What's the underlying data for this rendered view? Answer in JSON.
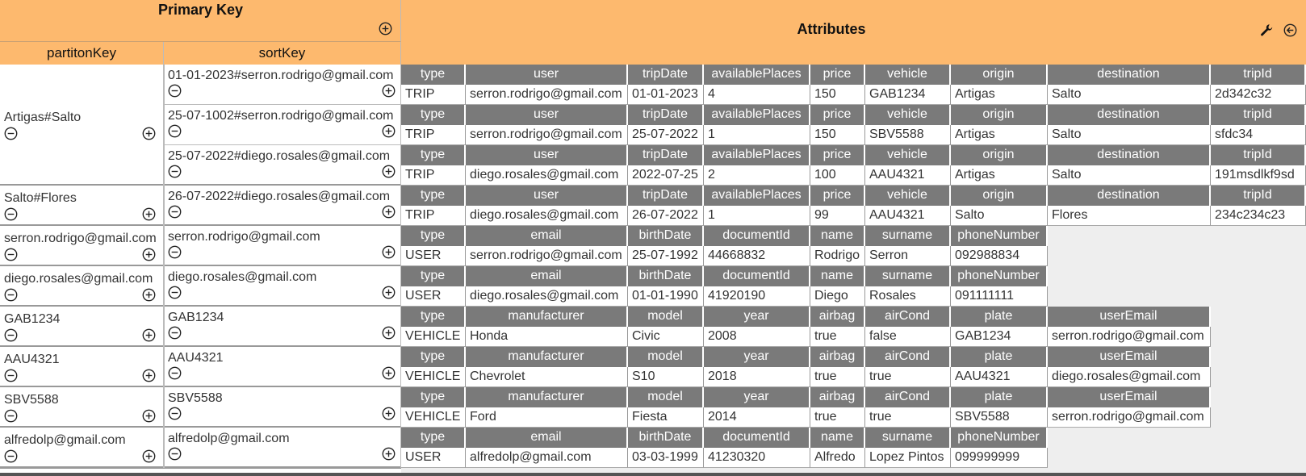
{
  "header": {
    "primary_key_title": "Primary Key",
    "attributes_title": "Attributes",
    "partition_col": "partitonKey",
    "sort_col": "sortKey"
  },
  "partitions": [
    {
      "key": "Artigas#Salto",
      "sorts": [
        "01-01-2023#serron.rodrigo@gmail.com",
        "25-07-1002#serron.rodrigo@gmail.com",
        "25-07-2022#diego.rosales@gmail.com"
      ]
    },
    {
      "key": "Salto#Flores",
      "sorts": [
        "26-07-2022#diego.rosales@gmail.com"
      ]
    },
    {
      "key": "serron.rodrigo@gmail.com",
      "sorts": [
        "serron.rodrigo@gmail.com"
      ]
    },
    {
      "key": "diego.rosales@gmail.com",
      "sorts": [
        "diego.rosales@gmail.com"
      ]
    },
    {
      "key": "GAB1234",
      "sorts": [
        "GAB1234"
      ]
    },
    {
      "key": "AAU4321",
      "sorts": [
        "AAU4321"
      ]
    },
    {
      "key": "SBV5588",
      "sorts": [
        "SBV5588"
      ]
    },
    {
      "key": "alfredolp@gmail.com",
      "sorts": [
        "alfredolp@gmail.com"
      ]
    }
  ],
  "items": [
    {
      "headers": [
        "type",
        "user",
        "tripDate",
        "availablePlaces",
        "price",
        "vehicle",
        "origin",
        "destination",
        "tripId"
      ],
      "values": [
        "TRIP",
        "serron.rodrigo@gmail.com",
        "01-01-2023",
        "4",
        "150",
        "GAB1234",
        "Artigas",
        "Salto",
        "2d342c32"
      ]
    },
    {
      "headers": [
        "type",
        "user",
        "tripDate",
        "availablePlaces",
        "price",
        "vehicle",
        "origin",
        "destination",
        "tripId"
      ],
      "values": [
        "TRIP",
        "serron.rodrigo@gmail.com",
        "25-07-2022",
        "1",
        "150",
        "SBV5588",
        "Artigas",
        "Salto",
        "sfdc34"
      ]
    },
    {
      "headers": [
        "type",
        "user",
        "tripDate",
        "availablePlaces",
        "price",
        "vehicle",
        "origin",
        "destination",
        "tripId"
      ],
      "values": [
        "TRIP",
        "diego.rosales@gmail.com",
        "2022-07-25",
        "2",
        "100",
        "AAU4321",
        "Artigas",
        "Salto",
        "191msdlkf9sd"
      ]
    },
    {
      "headers": [
        "type",
        "user",
        "tripDate",
        "availablePlaces",
        "price",
        "vehicle",
        "origin",
        "destination",
        "tripId"
      ],
      "values": [
        "TRIP",
        "diego.rosales@gmail.com",
        "26-07-2022",
        "1",
        "99",
        "AAU4321",
        "Salto",
        "Flores",
        "234c234c23"
      ]
    },
    {
      "headers": [
        "type",
        "email",
        "birthDate",
        "documentId",
        "name",
        "surname",
        "phoneNumber"
      ],
      "values": [
        "USER",
        "serron.rodrigo@gmail.com",
        "25-07-1992",
        "44668832",
        "Rodrigo",
        "Serron",
        "092988834"
      ]
    },
    {
      "headers": [
        "type",
        "email",
        "birthDate",
        "documentId",
        "name",
        "surname",
        "phoneNumber"
      ],
      "values": [
        "USER",
        "diego.rosales@gmail.com",
        "01-01-1990",
        "41920190",
        "Diego",
        "Rosales",
        "091111111"
      ]
    },
    {
      "headers": [
        "type",
        "manufacturer",
        "model",
        "year",
        "airbag",
        "airCond",
        "plate",
        "userEmail"
      ],
      "values": [
        "VEHICLE",
        "Honda",
        "Civic",
        "2008",
        "true",
        "false",
        "GAB1234",
        "serron.rodrigo@gmail.com"
      ]
    },
    {
      "headers": [
        "type",
        "manufacturer",
        "model",
        "year",
        "airbag",
        "airCond",
        "plate",
        "userEmail"
      ],
      "values": [
        "VEHICLE",
        "Chevrolet",
        "S10",
        "2018",
        "true",
        "true",
        "AAU4321",
        "diego.rosales@gmail.com"
      ]
    },
    {
      "headers": [
        "type",
        "manufacturer",
        "model",
        "year",
        "airbag",
        "airCond",
        "plate",
        "userEmail"
      ],
      "values": [
        "VEHICLE",
        "Ford",
        "Fiesta",
        "2014",
        "true",
        "true",
        "SBV5588",
        "serron.rodrigo@gmail.com"
      ]
    },
    {
      "headers": [
        "type",
        "email",
        "birthDate",
        "documentId",
        "name",
        "surname",
        "phoneNumber"
      ],
      "values": [
        "USER",
        "alfredolp@gmail.com",
        "03-03-1999",
        "41230320",
        "Alfredo",
        "Lopez Pintos",
        "099999999"
      ]
    }
  ],
  "colors": {
    "header_bg": "#fdb96e",
    "attr_header_bg": "#7a7a7a",
    "grid_bg": "#eeeeee"
  },
  "icons": {
    "add": "plus-circle-icon",
    "remove": "minus-circle-icon",
    "settings": "wrench-icon",
    "collapse": "arrow-left-circle-icon"
  }
}
